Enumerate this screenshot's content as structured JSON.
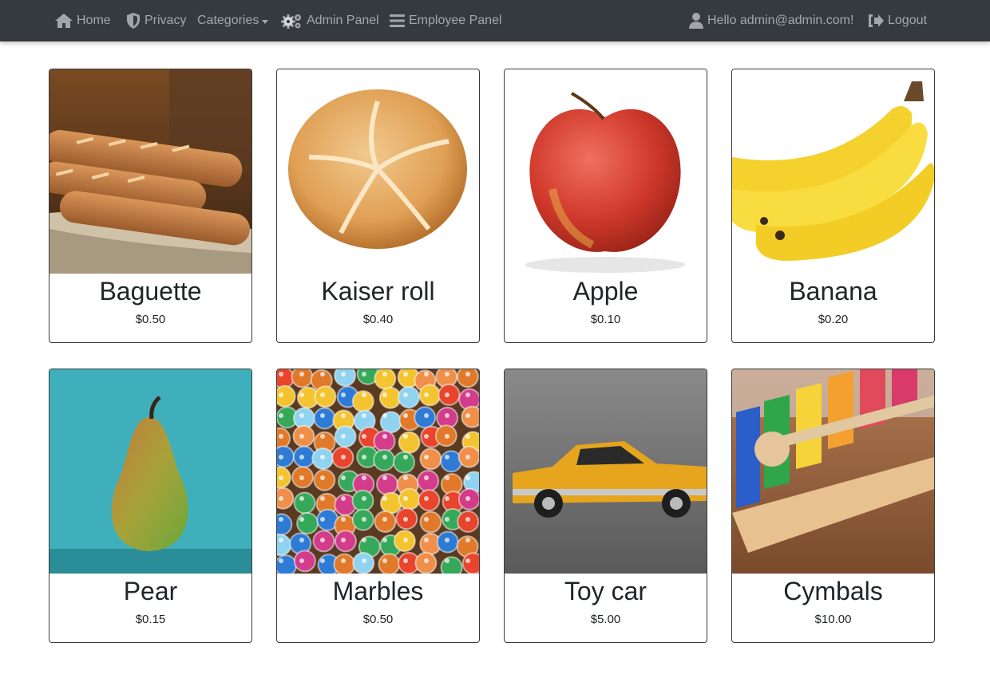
{
  "nav": {
    "home": "Home",
    "privacy": "Privacy",
    "categories": "Categories",
    "admin_panel": "Admin Panel",
    "employee_panel": "Employee Panel",
    "greeting": "Hello admin@admin.com!",
    "logout": "Logout"
  },
  "icons": {
    "home": "home-icon",
    "privacy": "shield-icon",
    "admin": "gears-icon",
    "employee": "bars-icon",
    "user": "user-icon",
    "logout": "sign-out-icon"
  },
  "colors": {
    "navbar_bg": "#343a40",
    "nav_text": "rgba(255,255,255,0.55)"
  },
  "products": [
    {
      "name": "Baguette",
      "price": "$0.50",
      "image": "baguette-image"
    },
    {
      "name": "Kaiser roll",
      "price": "$0.40",
      "image": "kaiser-roll-image"
    },
    {
      "name": "Apple",
      "price": "$0.10",
      "image": "apple-image"
    },
    {
      "name": "Banana",
      "price": "$0.20",
      "image": "banana-image"
    },
    {
      "name": "Pear",
      "price": "$0.15",
      "image": "pear-image"
    },
    {
      "name": "Marbles",
      "price": "$0.50",
      "image": "marbles-image"
    },
    {
      "name": "Toy car",
      "price": "$5.00",
      "image": "toy-car-image"
    },
    {
      "name": "Cymbals",
      "price": "$10.00",
      "image": "xylophone-image"
    }
  ]
}
